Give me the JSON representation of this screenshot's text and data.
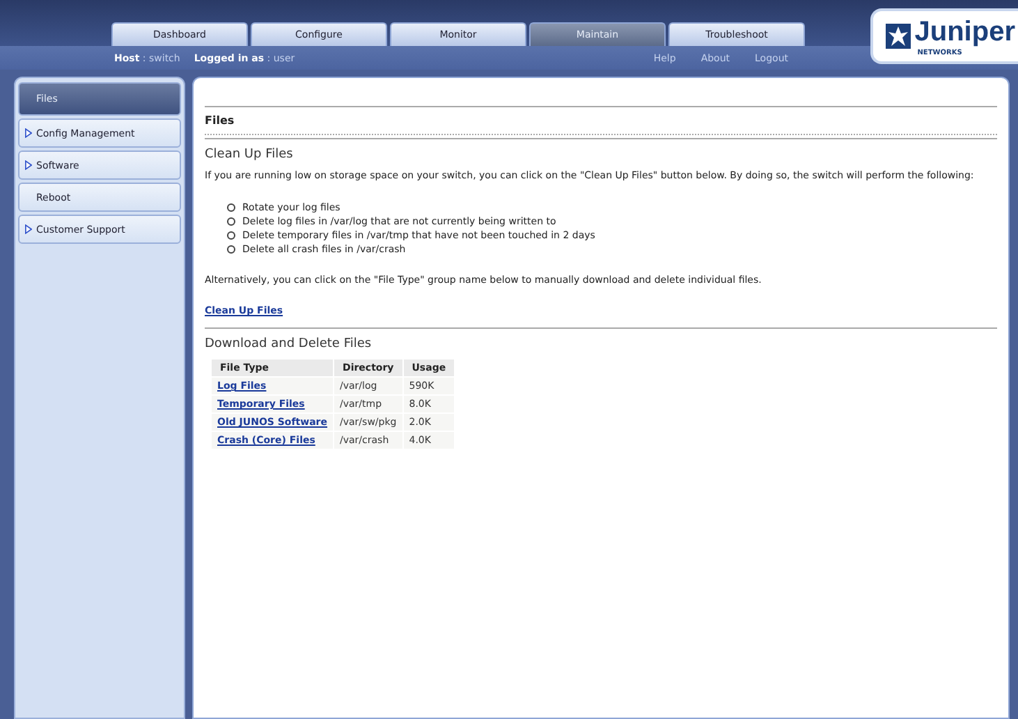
{
  "tabs": [
    {
      "label": "Dashboard",
      "selected": false
    },
    {
      "label": "Configure",
      "selected": false
    },
    {
      "label": "Monitor",
      "selected": false
    },
    {
      "label": "Maintain",
      "selected": true
    },
    {
      "label": "Troubleshoot",
      "selected": false
    }
  ],
  "session": {
    "host_label": "Host",
    "host": ": switch",
    "user_label": "Logged in as",
    "user": ": user"
  },
  "header_links": [
    "Help",
    "About",
    "Logout"
  ],
  "logo": {
    "name": "Juniper",
    "tagline": "NETWORKS"
  },
  "sidebar": {
    "items": [
      {
        "label": "Files",
        "selected": true,
        "expandable": false
      },
      {
        "label": "Config Management",
        "selected": false,
        "expandable": true
      },
      {
        "label": "Software",
        "selected": false,
        "expandable": true
      },
      {
        "label": "Reboot",
        "selected": false,
        "expandable": false
      },
      {
        "label": "Customer Support",
        "selected": false,
        "expandable": true
      }
    ]
  },
  "page": {
    "title": "Files",
    "cleanup": {
      "heading": "Clean Up Files",
      "intro": "If you are running low on storage space on your switch, you can click on the \"Clean Up Files\" button below. By doing so, the switch will perform the following:",
      "steps": [
        "Rotate your log files",
        "Delete log files in /var/log that are not currently being written to",
        "Delete temporary files in /var/tmp that have not been touched in 2 days",
        "Delete all crash files in /var/crash"
      ],
      "note": "Alternatively, you can click on the \"File Type\" group name below to manually download and delete individual files.",
      "link": "Clean Up Files"
    },
    "download": {
      "heading": "Download and Delete Files",
      "columns": [
        "File Type",
        "Directory",
        "Usage"
      ],
      "rows": [
        [
          "Log Files",
          "/var/log",
          "590K"
        ],
        [
          "Temporary Files",
          "/var/tmp",
          "8.0K"
        ],
        [
          "Old JUNOS Software",
          "/var/sw/pkg",
          "2.0K"
        ],
        [
          "Crash (Core) Files",
          "/var/crash",
          "4.0K"
        ]
      ]
    }
  }
}
